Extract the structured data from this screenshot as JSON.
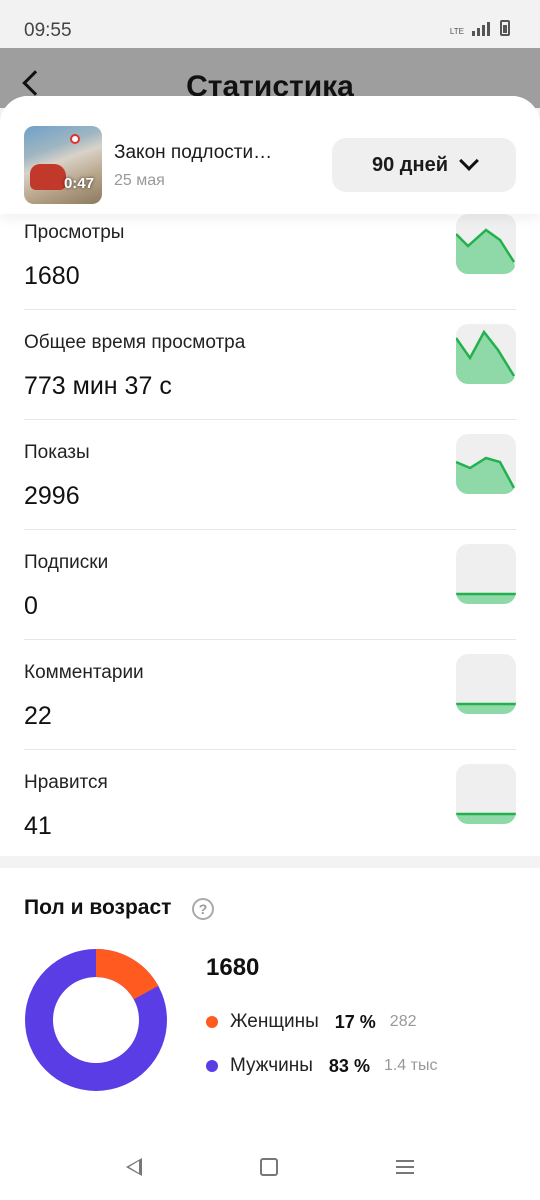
{
  "status_bar": {
    "time": "09:55",
    "network": "LTE"
  },
  "header": {
    "title": "Статистика"
  },
  "video": {
    "title": "Закон подлости…",
    "date": "25 мая",
    "duration": "0:47"
  },
  "period": {
    "label": "90 дней"
  },
  "metrics": [
    {
      "label": "Просмотры",
      "value": "1680",
      "trend": "up-down"
    },
    {
      "label": "Общее время просмотра",
      "value": "773 мин 37 с",
      "trend": "up-down"
    },
    {
      "label": "Показы",
      "value": "2996",
      "trend": "down-steep"
    },
    {
      "label": "Подписки",
      "value": "0",
      "trend": "flat"
    },
    {
      "label": "Комментарии",
      "value": "22",
      "trend": "flat"
    },
    {
      "label": "Нравится",
      "value": "41",
      "trend": "flat"
    }
  ],
  "demographics": {
    "title": "Пол и возраст",
    "total": "1680",
    "items": [
      {
        "name": "Женщины",
        "percent": "17 %",
        "count": "282",
        "color": "#ff5a1f",
        "fraction": 0.17
      },
      {
        "name": "Мужчины",
        "percent": "83 %",
        "count": "1.4 тыс",
        "color": "#5b3de6",
        "fraction": 0.83
      }
    ]
  },
  "colors": {
    "spark_fill": "#8fd8a8",
    "spark_line": "#22b14c"
  }
}
